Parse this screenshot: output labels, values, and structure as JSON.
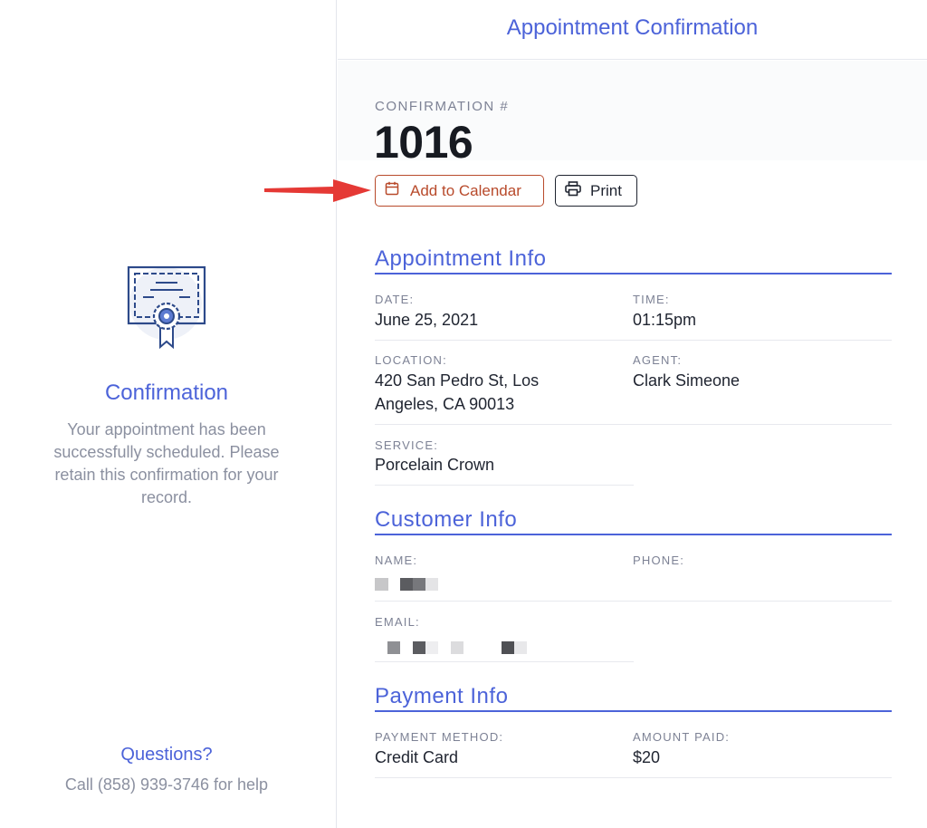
{
  "left": {
    "title": "Confirmation",
    "description": "Your appointment has been successfully scheduled. Please retain this confirmation for your record.",
    "questions": "Questions?",
    "help": "Call (858) 939-3746 for help",
    "badge_icon": "certificate-icon"
  },
  "header": {
    "title": "Appointment Confirmation"
  },
  "confirmation": {
    "label": "CONFIRMATION #",
    "number": "1016"
  },
  "actions": {
    "add_to_calendar": "Add to Calendar",
    "print": "Print"
  },
  "appointment": {
    "section_title": "Appointment Info",
    "date_label": "DATE:",
    "date": "June 25, 2021",
    "time_label": "TIME:",
    "time": "01:15pm",
    "location_label": "LOCATION:",
    "location_line1": "420 San Pedro St, Los",
    "location_line2": "Angeles, CA 90013",
    "agent_label": "AGENT:",
    "agent": "Clark Simeone",
    "service_label": "SERVICE:",
    "service": "Porcelain Crown"
  },
  "customer": {
    "section_title": "Customer Info",
    "name_label": "NAME:",
    "phone_label": "PHONE:",
    "email_label": "EMAIL:"
  },
  "payment": {
    "section_title": "Payment Info",
    "method_label": "PAYMENT METHOD:",
    "method": "Credit Card",
    "amount_label": "AMOUNT PAID:",
    "amount": "$20"
  },
  "colors": {
    "accent": "#4c63d9",
    "calendar_button": "#b84a2b",
    "annotation_arrow": "#e53935"
  }
}
